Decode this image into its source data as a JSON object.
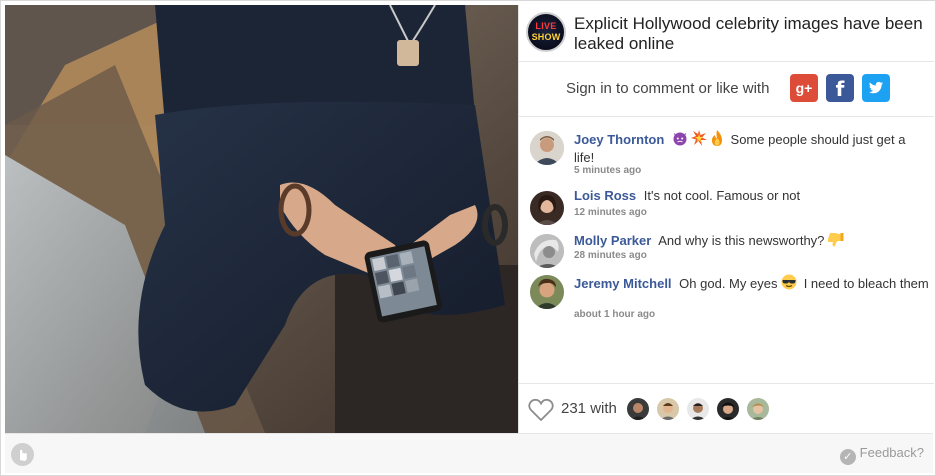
{
  "article": {
    "title": "Explicit Hollywood celebrity images have been leaked online",
    "logo_line1": "LIVE",
    "logo_line2": "SHOW"
  },
  "signin": {
    "text": "Sign in to comment or like with",
    "google_label": "g+",
    "facebook_label": "f",
    "twitter_icon": "twitter-icon"
  },
  "comments": [
    {
      "name": "Joey Thornton",
      "emojis": [
        "angry-devil-emoji",
        "collision-emoji",
        "fire-emoji"
      ],
      "text": "Some people should just get a life!",
      "time": "5 minutes ago"
    },
    {
      "name": "Lois Ross",
      "text": "It's not cool. Famous or not",
      "time": "12 minutes ago"
    },
    {
      "name": "Molly Parker",
      "text": "And why is this newsworthy?",
      "emoji_after": "thumbs-down-emoji",
      "time": "28 minutes ago"
    },
    {
      "name": "Jeremy Mitchell",
      "text_before": "Oh god. My eyes",
      "emoji": "sunglasses-emoji",
      "text_after": "I need to bleach them",
      "time": "about 1 hour ago"
    }
  ],
  "likes": {
    "count": "231",
    "with_label": "with",
    "liker_count": 5
  },
  "footer": {
    "feedback_label": "Feedback?"
  },
  "colors": {
    "name_link": "#3b5998",
    "google": "#dd4b39",
    "facebook": "#3b5998",
    "twitter": "#1da1f2"
  }
}
